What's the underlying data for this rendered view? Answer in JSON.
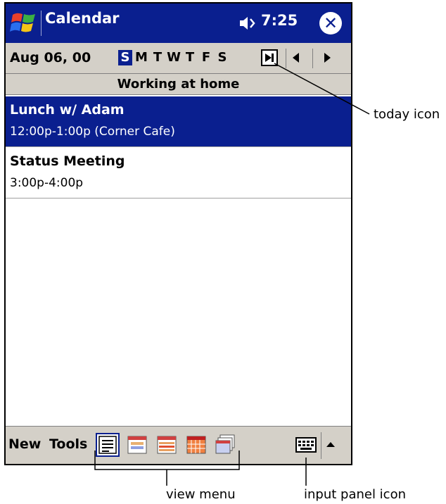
{
  "window": {
    "title": "Calendar",
    "clock": "7:25",
    "close_glyph": "✕"
  },
  "date_bar": {
    "date": "Aug 06, 00",
    "days": [
      "S",
      "M",
      "T",
      "W",
      "T",
      "F",
      "S"
    ],
    "selected_day_index": 0
  },
  "all_day_event": "Working at home",
  "appointments": [
    {
      "subject": "Lunch w/ Adam",
      "time": "12:00p-1:00p (Corner Cafe)",
      "selected": true
    },
    {
      "subject": "Status Meeting",
      "time": "3:00p-4:00p",
      "selected": false
    }
  ],
  "menubar": {
    "new_label": "New",
    "tools_label": "Tools",
    "views": [
      "agenda-view-icon",
      "day-view-icon",
      "week-view-icon",
      "month-view-icon",
      "year-view-icon"
    ]
  },
  "callouts": {
    "today_icon": "today icon",
    "view_menu": "view menu",
    "input_panel_icon": "input panel icon"
  },
  "colors": {
    "titlebar": "#0a1f8f",
    "chrome": "#d4d0c8",
    "selection": "#0a1f8f"
  }
}
